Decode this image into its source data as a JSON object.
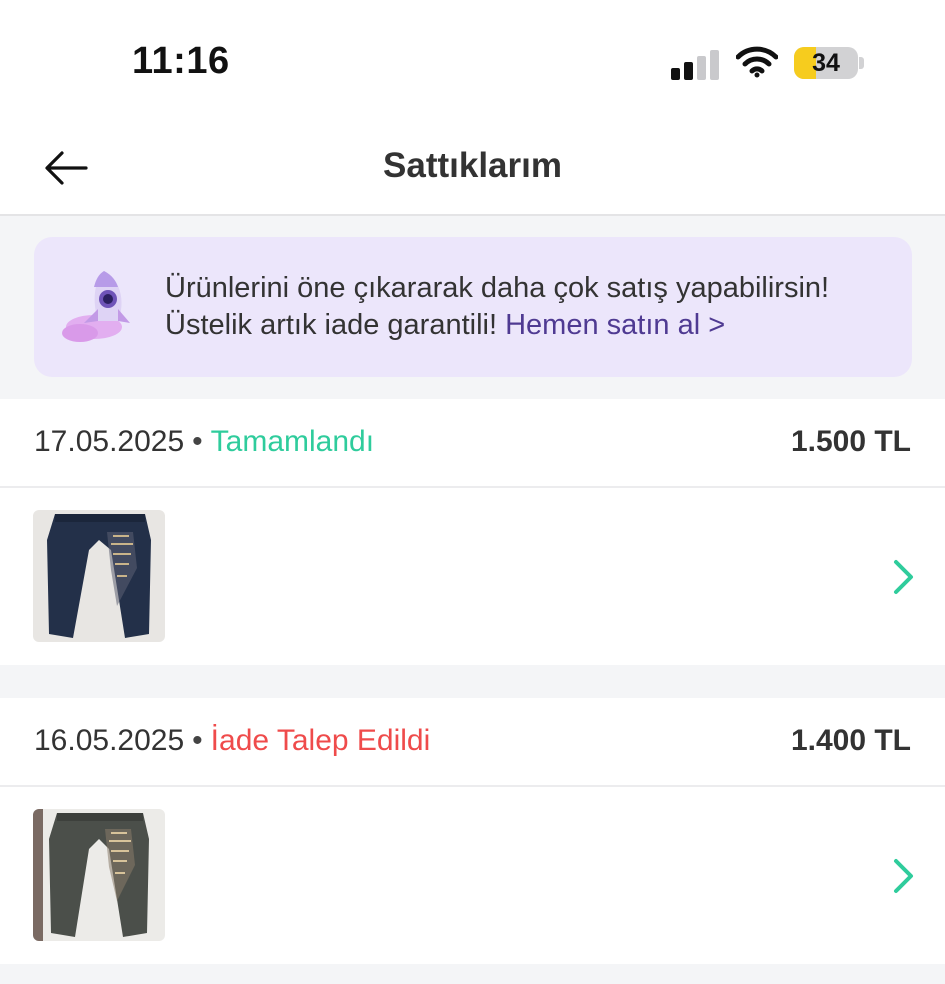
{
  "status_bar": {
    "time": "11:16",
    "battery_level": 34,
    "battery_label": "34",
    "signal_icon": "cellular-signal-icon",
    "wifi_icon": "wifi-icon"
  },
  "nav": {
    "title": "Sattıklarım",
    "back_icon": "arrow-left-icon"
  },
  "promo": {
    "icon": "rocket-icon",
    "text_line1": "Ürünlerini öne çıkararak daha çok satış yapabilirsin!",
    "text_line2": "Üstelik artık iade garantili!",
    "link_text": "Hemen satın al >"
  },
  "orders": [
    {
      "date": "17.05.2025",
      "separator": "•",
      "status": "Tamamlandı",
      "price": "1.500 TL",
      "thumbnail": "navy-sweatpants-photo"
    },
    {
      "date": "16.05.2025",
      "separator": "•",
      "status": "İade Talep Edildi",
      "price": "1.400 TL",
      "thumbnail": "gray-sweatpants-photo"
    }
  ],
  "colors": {
    "status_completed": "#2fcc9c",
    "status_return": "#ef4b4b",
    "chevron": "#2fcc9c",
    "promo_bg": "#ece6fb",
    "promo_link": "#4f3a92",
    "battery_fill": "#f6cc1e"
  }
}
